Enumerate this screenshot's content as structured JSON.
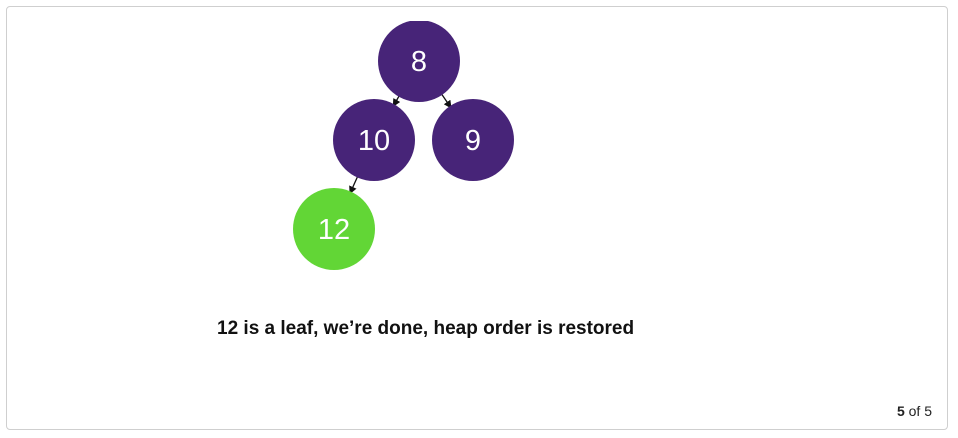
{
  "colors": {
    "node_default": "#472478",
    "node_highlight": "#62d636",
    "edge": "#111111"
  },
  "diagram": {
    "nodes": [
      {
        "id": "n8",
        "label": "8",
        "state": "default"
      },
      {
        "id": "n10",
        "label": "10",
        "state": "default"
      },
      {
        "id": "n9",
        "label": "9",
        "state": "default"
      },
      {
        "id": "n12",
        "label": "12",
        "state": "highlight"
      }
    ],
    "edges": [
      {
        "from": "n8",
        "to": "n10"
      },
      {
        "from": "n8",
        "to": "n9"
      },
      {
        "from": "n10",
        "to": "n12"
      }
    ]
  },
  "caption": "12 is a leaf, we’re done, heap order is restored",
  "pager": {
    "current": "5",
    "separator": "of",
    "total": "5"
  }
}
